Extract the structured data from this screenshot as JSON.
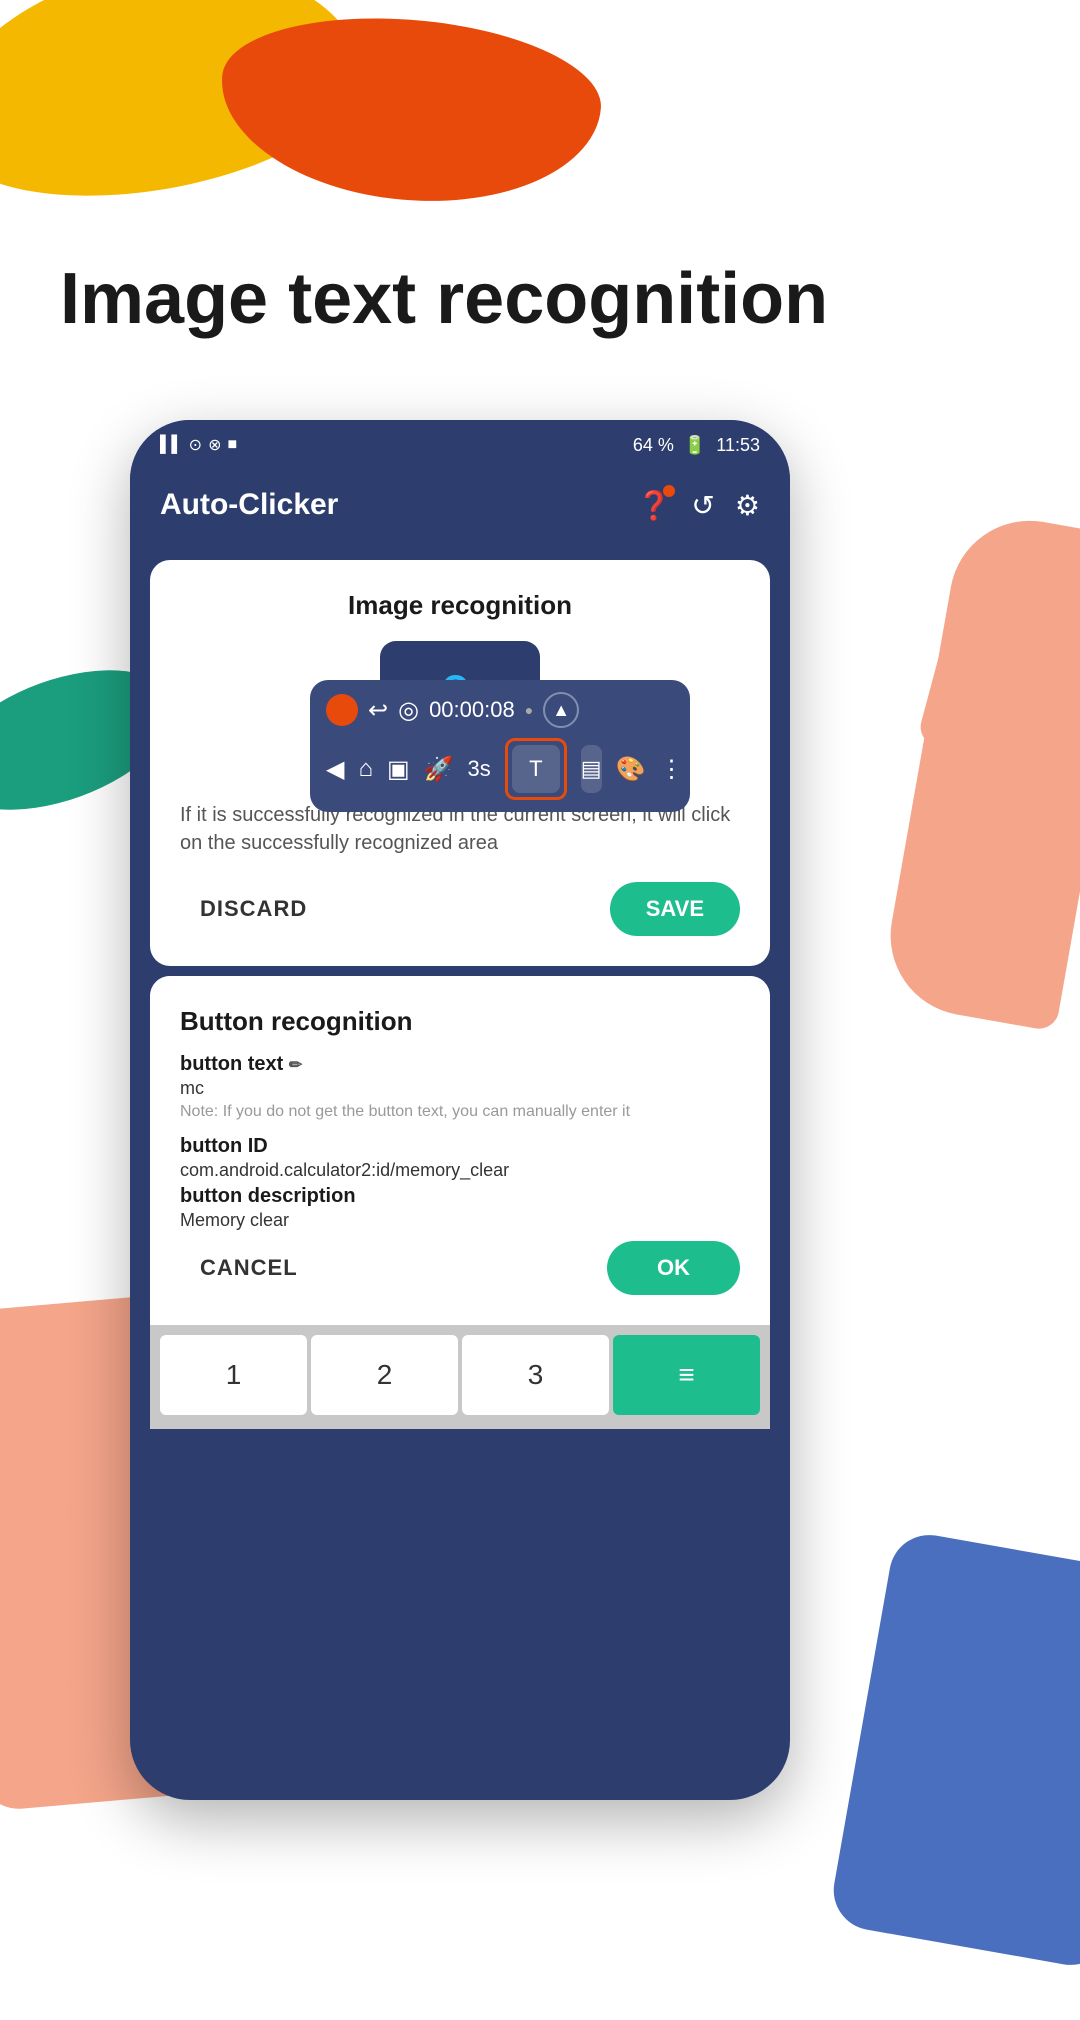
{
  "page": {
    "title": "Image text recognition",
    "background": "#ffffff"
  },
  "decorations": {
    "blob_yellow_color": "#F5B800",
    "blob_orange_color": "#E84A0C",
    "blob_green_color": "#1B9E7E"
  },
  "status_bar": {
    "battery": "64 %",
    "time": "11:53",
    "signal_icons": "▌▌ ⊙ ⊗ ■"
  },
  "app_bar": {
    "title": "Auto-Clicker",
    "help_icon": "?",
    "history_icon": "↺",
    "settings_icon": "⚙"
  },
  "image_recognition_card": {
    "title": "Image recognition",
    "description": "If it is successfully recognized in the current screen, it will click on the successfully recognized area",
    "discard_label": "DISCARD",
    "save_label": "SAVE"
  },
  "floating_toolbar": {
    "timer": "00:00:08",
    "seconds_label": "3s"
  },
  "button_recognition_card": {
    "title": "Button recognition",
    "button_text_label": "button text",
    "button_text_value": "mc",
    "button_text_note": "Note: If you do not get the button text, you can manually enter it",
    "button_id_label": "button ID",
    "button_id_value": "com.android.calculator2:id/memory_clear",
    "button_description_label": "button description",
    "button_description_value": "Memory clear",
    "cancel_label": "CANCEL",
    "ok_label": "OK"
  },
  "calculator": {
    "keys_row1": [
      "1",
      "2",
      "3"
    ],
    "teal_key": "≡"
  }
}
